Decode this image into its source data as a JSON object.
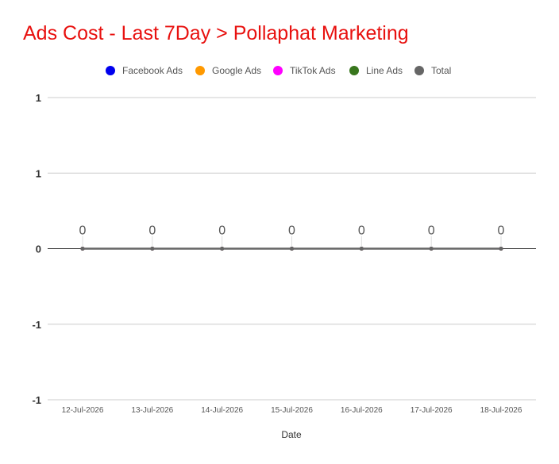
{
  "chart_data": {
    "type": "line",
    "title": "Ads Cost - Last 7Day > Pollaphat Marketing",
    "xlabel": "Date",
    "ylabel": "",
    "categories": [
      "12-Jul-2026",
      "13-Jul-2026",
      "14-Jul-2026",
      "15-Jul-2026",
      "16-Jul-2026",
      "17-Jul-2026",
      "18-Jul-2026"
    ],
    "ylim": [
      -1,
      1
    ],
    "y_ticks": [
      "1",
      "1",
      "0",
      "-1",
      "-1"
    ],
    "y_tick_values": [
      1,
      0.5,
      0,
      -0.5,
      -1
    ],
    "grid": true,
    "legend_position": "top",
    "series": [
      {
        "name": "Facebook Ads",
        "color": "#0000ee",
        "values": [
          0,
          0,
          0,
          0,
          0,
          0,
          0
        ]
      },
      {
        "name": "Google Ads",
        "color": "#ff9900",
        "values": [
          0,
          0,
          0,
          0,
          0,
          0,
          0
        ]
      },
      {
        "name": "TikTok Ads",
        "color": "#ff00ff",
        "values": [
          0,
          0,
          0,
          0,
          0,
          0,
          0
        ]
      },
      {
        "name": "Line Ads",
        "color": "#38761d",
        "values": [
          0,
          0,
          0,
          0,
          0,
          0,
          0
        ]
      },
      {
        "name": "Total",
        "color": "#666666",
        "values": [
          0,
          0,
          0,
          0,
          0,
          0,
          0
        ]
      }
    ],
    "data_labels": [
      "0",
      "0",
      "0",
      "0",
      "0",
      "0",
      "0"
    ]
  }
}
